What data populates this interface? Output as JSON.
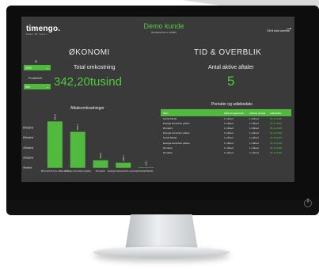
{
  "header": {
    "logo": "timengo.",
    "logo_tagline": "Power BI report",
    "title": "Demo kunde",
    "subtitle": "(Kundenummer: 12345)",
    "nav_link": "Gå til total overblik",
    "nav_icon": "arrow-right-icon"
  },
  "sections": {
    "okonomi": "ØKONOMI",
    "tid": "TID & OVERBLIK"
  },
  "filters": {
    "year_label": "År",
    "year_value": "2020",
    "product_label": "Produkt/ref",
    "product_value": "Alle"
  },
  "kpis": {
    "cost_label": "Total omkostning",
    "cost_value": "342,20tusind",
    "agreements_label": "Antal aktive aftaler",
    "agreements_value": "5"
  },
  "chart_title": "Aftaleomkostninger",
  "chart_data": {
    "type": "bar",
    "title": "Aftaleomkostninger",
    "categories": [
      "Microsoft Azure aftale m.fl.",
      "Energie konsulent ydelse",
      "Domains",
      "Energie Selvservice og kunde",
      "Social Media"
    ],
    "values": [
      93,
      72,
      15,
      10,
      1
    ],
    "data_labels": [
      "93,4 t",
      "72,0 t",
      "15,0 t",
      "10,0 t",
      "1,0 t"
    ],
    "y_tick_labels": [
      "80tusind",
      "60tusind",
      "40tusind",
      "20tusind",
      "0tusind"
    ],
    "y_ticks": [
      80,
      60,
      40,
      20,
      0
    ],
    "ylim": [
      0,
      100
    ],
    "grid": false
  },
  "table": {
    "title": "Perioder og udløbsdato",
    "headers": [
      "Navn",
      "Faktureringsperiode",
      "Afsluttet periode",
      "Udløbsdato"
    ],
    "rows": [
      [
        "Social Media",
        "1 måned",
        "1 måned",
        "30-11-2020"
      ],
      [
        "Energie konsulent ydelse",
        "1 måned",
        "1 måned",
        "20-11-2020"
      ],
      [
        "Domains",
        "1 måned",
        "1 måned",
        "28-11-2020"
      ],
      [
        "Energie konsulent ydelse",
        "1 måned",
        "1 måned",
        "01-12-2020"
      ],
      [
        "Social Media",
        "1 måned",
        "1 måned",
        "20-12-2020"
      ],
      [
        "Energie konsulent ydelse",
        "1 måned",
        "1 måned",
        "28-12-2020"
      ],
      [
        "Domains",
        "1 måned",
        "1 måned",
        "25-12-2020"
      ],
      [
        "Domains",
        "1 måned",
        "1 måned",
        "30-12-2020"
      ]
    ]
  },
  "colors": {
    "accent": "#4fcb3a",
    "screen_bg": "#3a3a3a",
    "bar": "#52b93f"
  }
}
